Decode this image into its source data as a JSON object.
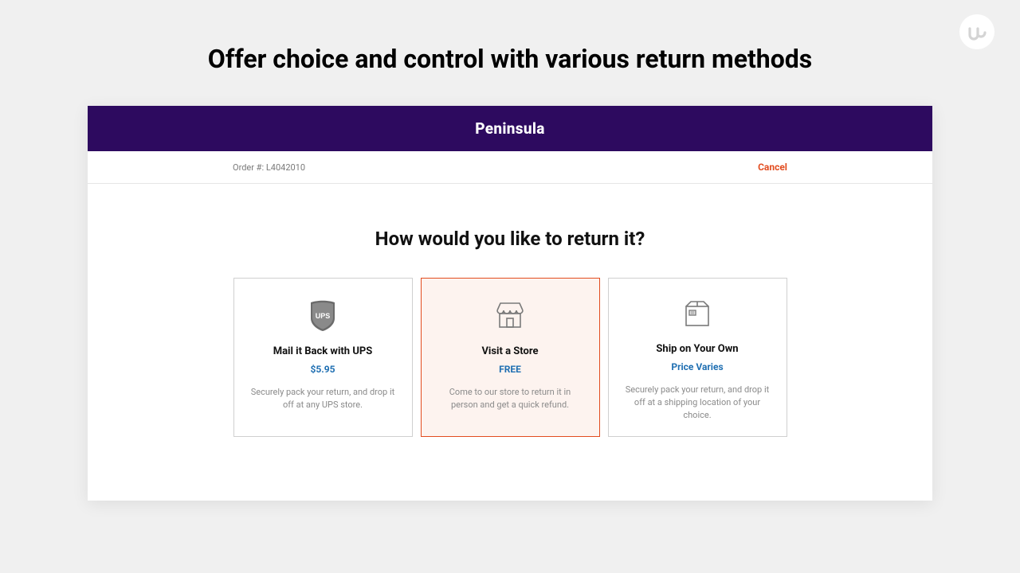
{
  "hero": {
    "title": "Offer choice and control with various return methods"
  },
  "brand": {
    "name": "Peninsula"
  },
  "meta": {
    "order_label": "Order #: L4042010",
    "cancel": "Cancel"
  },
  "question": "How would you like to return it?",
  "options": [
    {
      "title": "Mail it Back with UPS",
      "price": "$5.95",
      "desc": "Securely pack your return, and drop it off at any UPS store."
    },
    {
      "title": "Visit a Store",
      "price": "FREE",
      "desc": "Come to our store to return it in person and get a quick refund."
    },
    {
      "title": "Ship on Your Own",
      "price": "Price Varies",
      "desc": "Securely pack your return, and drop it off at a shipping location of your choice."
    }
  ]
}
